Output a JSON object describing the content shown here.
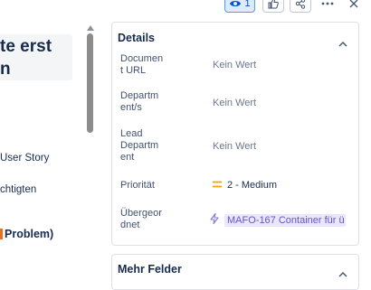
{
  "issue": {
    "title_line1": "te erst",
    "title_line2": "n"
  },
  "left_panel": {
    "items": [
      {
        "text": "User Story"
      },
      {
        "text": "chtigten"
      },
      {
        "text": "Problem)"
      }
    ]
  },
  "toolbar": {
    "watch_count": "1",
    "icons": [
      "eye-icon",
      "thumbs-up-icon",
      "share-icon",
      "more-icon",
      "close-icon"
    ]
  },
  "details": {
    "header": "Details",
    "fields": [
      {
        "label": "Document URL",
        "value": "Kein Wert"
      },
      {
        "label": "Departm ent/s",
        "value": "Kein Wert"
      },
      {
        "label": "Lead Departm ent",
        "value": "Kein Wert"
      },
      {
        "label": "Priorität",
        "value": "2 - Medium"
      },
      {
        "label": "Übergeor dnet",
        "value": "MAFO-167 Container für ü"
      }
    ]
  },
  "more_fields": {
    "header": "Mehr Felder"
  },
  "colors": {
    "priority_medium": "#f4a100",
    "parent_icon": "#8777d9",
    "parent_chip_bg": "#eae6ff"
  }
}
